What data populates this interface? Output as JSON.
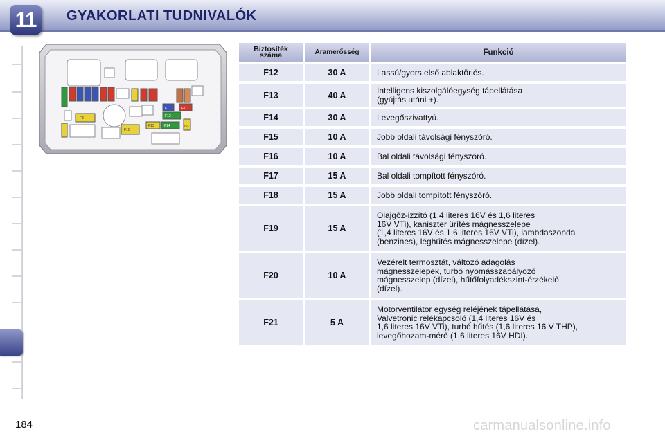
{
  "header": {
    "chapter_number": "11",
    "title": "GYAKORLATI TUDNIVALÓK"
  },
  "fusebox_labels": [
    "F1",
    "F12",
    "F14",
    "F13",
    "F7",
    "F8",
    "F10",
    "F21"
  ],
  "table": {
    "headers": {
      "fuse_line1": "Biztosíték",
      "fuse_line2": "száma",
      "amperage": "Áramerősség",
      "function": "Funkció"
    },
    "rows": [
      {
        "fuse": "F12",
        "amps": "30 A",
        "lines": [
          "Lassú/gyors első ablaktörlés."
        ]
      },
      {
        "fuse": "F13",
        "amps": "40 A",
        "lines": [
          "Intelligens kiszolgálóegység tápellátása",
          "(gyújtás utáni +)."
        ]
      },
      {
        "fuse": "F14",
        "amps": "30 A",
        "lines": [
          "Levegőszivattyú."
        ]
      },
      {
        "fuse": "F15",
        "amps": "10 A",
        "lines": [
          "Jobb oldali távolsági fényszóró."
        ]
      },
      {
        "fuse": "F16",
        "amps": "10 A",
        "lines": [
          "Bal oldali távolsági fényszóró."
        ]
      },
      {
        "fuse": "F17",
        "amps": "15 A",
        "lines": [
          "Bal oldali tompított fényszóró."
        ]
      },
      {
        "fuse": "F18",
        "amps": "15 A",
        "lines": [
          "Jobb oldali tompított fényszóró."
        ]
      },
      {
        "fuse": "F19",
        "amps": "15 A",
        "lines": [
          "Olajgőz-izzító (1,4 literes 16V és 1,6 literes",
          "16V VTi), kaniszter ürítés mágnesszelepe",
          "(1,4 literes 16V és 1,6 literes 16V VTi), lambdaszonda",
          "(benzines), léghűtés mágnesszelepe (dízel)."
        ]
      },
      {
        "fuse": "F20",
        "amps": "10 A",
        "lines": [
          "Vezérelt termosztát, változó adagolás",
          "mágnesszelepek, turbó nyomásszabályozó",
          "mágnesszelep (dízel), hűtőfolyadékszint-érzékelő",
          "(dízel)."
        ]
      },
      {
        "fuse": "F21",
        "amps": "5 A",
        "lines": [
          "Motorventilátor egység reléjének tápellátása,",
          "Valvetronic relékapcsoló (1,4 literes 16V és",
          "1,6 literes 16V VTi), turbó hűtés (1,6 literes 16 V THP),",
          "levegőhozam-mérő (1,6 literes 16V HDI)."
        ]
      }
    ]
  },
  "footer": {
    "page_number": "184",
    "watermark": "carmanualsonline.info"
  },
  "colors": {
    "header_blue": "#1c2266",
    "cell_bg": "#e5e7f2",
    "header_cell": "#aeb3d3"
  }
}
